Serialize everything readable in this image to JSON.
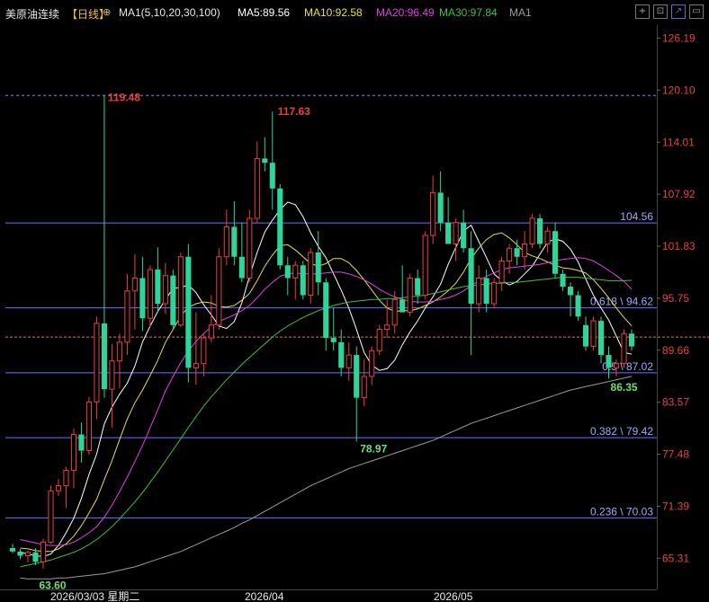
{
  "header": {
    "instrument": "美原油连续",
    "period": "【日线】",
    "target_icon": "crosshair-icon",
    "ma_params": "MA1(5,10,20,30,100)",
    "ma5": "MA5:89.56",
    "ma10": "MA10:92.58",
    "ma20": "MA20:96.49",
    "ma30": "MA30:97.84",
    "ma1": "MA1",
    "icons": [
      "cross-icon",
      "zoom-icon",
      "compare-icon",
      "window-icon"
    ]
  },
  "colors": {
    "up": "#e8403e",
    "down": "#2ed49a",
    "ma5": "#ffffff",
    "ma10": "#e6e040",
    "ma20": "#e040e0",
    "ma30": "#40c040",
    "ma100": "#9a9a9a",
    "fib": "#7070ff",
    "axis_text": "#e8403e",
    "current": "#e8743a"
  },
  "chart_data": {
    "type": "candlestick",
    "y_axis_ticks": [
      "126.19",
      "120.10",
      "114.01",
      "107.92",
      "101.83",
      "95.75",
      "89.66",
      "83.57",
      "77.48",
      "71.39",
      "65.31"
    ],
    "ylim": [
      62.5,
      127.5
    ],
    "x_labels": [
      "2026/03/03 星期二",
      "2026/04",
      "2026/05"
    ],
    "annotations": {
      "high_1": "119.48",
      "high_2": "117.63",
      "low_mid": "78.97",
      "low_start": "63.60",
      "low_recent": "86.35"
    },
    "fib_levels": [
      {
        "label": "104.56",
        "value": 104.56
      },
      {
        "label": "0.618 \\ 94.62",
        "value": 94.62
      },
      {
        "label": "0.5 \\ 87.02",
        "value": 87.02
      },
      {
        "label": "0.382 \\ 79.42",
        "value": 79.42
      },
      {
        "label": "0.236 \\ 70.03",
        "value": 70.03
      }
    ],
    "dashed_level": 119.48,
    "current_price": 91.2,
    "candles": [
      [
        66.5,
        67.0,
        65.9,
        66.1
      ],
      [
        66.1,
        66.4,
        65.2,
        65.6
      ],
      [
        65.6,
        66.2,
        64.8,
        66.0
      ],
      [
        66.0,
        66.5,
        64.5,
        64.9
      ],
      [
        64.9,
        67.6,
        64.1,
        67.2
      ],
      [
        67.2,
        73.8,
        67.0,
        73.2
      ],
      [
        73.2,
        74.6,
        72.6,
        73.8
      ],
      [
        73.8,
        76.0,
        71.2,
        75.6
      ],
      [
        75.6,
        80.5,
        73.5,
        79.8
      ],
      [
        79.8,
        81.2,
        76.5,
        77.9
      ],
      [
        77.9,
        84.2,
        77.4,
        83.6
      ],
      [
        83.6,
        93.6,
        81.6,
        92.8
      ],
      [
        92.8,
        119.5,
        84.1,
        85.1
      ],
      [
        85.1,
        90.4,
        80.6,
        88.4
      ],
      [
        88.4,
        91.6,
        85.2,
        90.6
      ],
      [
        90.6,
        98.6,
        89.1,
        96.6
      ],
      [
        96.6,
        100.9,
        92.1,
        98.1
      ],
      [
        98.1,
        100.6,
        91.9,
        93.4
      ],
      [
        93.4,
        99.6,
        92.4,
        99.1
      ],
      [
        99.1,
        101.7,
        94.1,
        95.1
      ],
      [
        95.1,
        99.9,
        93.9,
        98.4
      ],
      [
        98.4,
        99.1,
        92.1,
        92.6
      ],
      [
        92.6,
        101.1,
        92.4,
        100.6
      ],
      [
        100.6,
        102.1,
        85.9,
        87.6
      ],
      [
        87.6,
        94.1,
        85.6,
        88.1
      ],
      [
        88.1,
        91.6,
        86.6,
        91.1
      ],
      [
        91.1,
        96.1,
        90.6,
        92.6
      ],
      [
        92.6,
        101.6,
        92.1,
        100.6
      ],
      [
        100.6,
        106.1,
        99.6,
        104.1
      ],
      [
        104.1,
        107.1,
        99.6,
        100.6
      ],
      [
        100.6,
        104.6,
        97.6,
        98.1
      ],
      [
        98.1,
        106.1,
        97.6,
        105.1
      ],
      [
        105.1,
        114.1,
        104.6,
        112.1
      ],
      [
        112.1,
        114.6,
        110.6,
        111.6
      ],
      [
        111.6,
        117.6,
        106.1,
        108.6
      ],
      [
        108.6,
        109.1,
        99.1,
        99.6
      ],
      [
        99.6,
        100.6,
        96.1,
        98.1
      ],
      [
        98.1,
        100.1,
        95.6,
        99.6
      ],
      [
        99.6,
        100.1,
        95.6,
        96.1
      ],
      [
        96.1,
        101.6,
        95.1,
        101.1
      ],
      [
        101.1,
        103.6,
        96.1,
        97.6
      ],
      [
        97.6,
        98.1,
        89.6,
        91.1
      ],
      [
        91.1,
        94.6,
        89.6,
        90.6
      ],
      [
        90.6,
        92.1,
        86.6,
        87.6
      ],
      [
        87.6,
        90.6,
        86.1,
        89.1
      ],
      [
        89.1,
        90.1,
        78.97,
        84.1
      ],
      [
        84.1,
        88.6,
        83.1,
        86.6
      ],
      [
        86.6,
        90.1,
        85.6,
        89.6
      ],
      [
        89.6,
        92.6,
        89.1,
        92.1
      ],
      [
        92.1,
        95.6,
        91.1,
        92.6
      ],
      [
        92.6,
        96.6,
        91.6,
        95.6
      ],
      [
        95.6,
        99.6,
        94.6,
        94.1
      ],
      [
        94.1,
        98.6,
        93.6,
        98.1
      ],
      [
        98.1,
        99.1,
        95.1,
        96.1
      ],
      [
        96.1,
        103.6,
        95.6,
        103.1
      ],
      [
        103.1,
        110.1,
        102.1,
        108.1
      ],
      [
        108.1,
        110.6,
        103.6,
        104.6
      ],
      [
        104.6,
        107.6,
        102.6,
        102.1
      ],
      [
        102.1,
        105.1,
        100.1,
        104.6
      ],
      [
        104.6,
        106.1,
        101.1,
        101.6
      ],
      [
        101.6,
        103.6,
        89.1,
        95.1
      ],
      [
        95.1,
        99.6,
        94.1,
        98.1
      ],
      [
        98.1,
        99.1,
        94.1,
        95.1
      ],
      [
        95.1,
        98.1,
        94.6,
        97.6
      ],
      [
        97.6,
        100.6,
        96.6,
        100.1
      ],
      [
        100.1,
        102.1,
        98.6,
        101.6
      ],
      [
        101.6,
        102.6,
        99.6,
        100.6
      ],
      [
        100.6,
        103.6,
        99.1,
        102.1
      ],
      [
        102.1,
        105.6,
        101.6,
        105.1
      ],
      [
        105.1,
        105.6,
        101.6,
        102.1
      ],
      [
        102.1,
        104.1,
        101.1,
        103.6
      ],
      [
        103.6,
        104.6,
        98.1,
        98.6
      ],
      [
        98.6,
        99.1,
        96.6,
        97.1
      ],
      [
        97.1,
        97.6,
        93.6,
        96.1
      ],
      [
        96.1,
        96.6,
        93.1,
        93.6
      ],
      [
        92.6,
        93.6,
        89.6,
        90.1
      ],
      [
        90.1,
        93.6,
        89.6,
        93.1
      ],
      [
        93.1,
        93.6,
        88.1,
        89.1
      ],
      [
        89.1,
        90.1,
        86.35,
        87.6
      ],
      [
        87.6,
        88.6,
        86.6,
        88.1
      ],
      [
        88.1,
        92.1,
        87.6,
        91.6
      ],
      [
        91.6,
        92.1,
        89.6,
        90.1
      ]
    ],
    "moving_averages": [
      {
        "name": "MA5",
        "values": [
          66.0,
          65.8,
          65.6,
          65.5,
          65.8,
          66.8,
          68.3,
          70.0,
          72.3,
          75.1,
          77.5,
          81.0,
          83.0,
          84.5,
          85.8,
          87.8,
          90.6,
          92.5,
          94.2,
          95.6,
          96.9,
          97.0,
          97.3,
          96.4,
          95.0,
          93.8,
          92.5,
          92.2,
          93.0,
          95.2,
          98.3,
          101.1,
          103.5,
          104.9,
          106.1,
          107.0,
          106.7,
          105.3,
          103.4,
          101.8,
          100.5,
          98.6,
          96.7,
          94.6,
          92.1,
          89.4,
          87.9,
          87.3,
          87.5,
          88.5,
          90.3,
          91.8,
          93.1,
          94.6,
          95.9,
          97.4,
          99.7,
          101.7,
          103.6,
          104.3,
          102.4,
          100.5,
          98.6,
          97.8,
          97.3,
          97.7,
          98.6,
          99.5,
          100.9,
          102.3,
          102.7,
          102.4,
          101.5,
          100.0,
          98.0,
          96.1,
          94.6,
          93.2,
          91.3,
          89.4,
          89.2
        ]
      },
      {
        "name": "MA10",
        "values": [
          66.5,
          66.4,
          66.2,
          66.1,
          66.1,
          66.4,
          67.0,
          67.9,
          69.1,
          70.6,
          72.2,
          74.5,
          76.7,
          79.2,
          81.6,
          83.5,
          85.0,
          86.7,
          88.5,
          90.6,
          92.1,
          93.7,
          94.7,
          95.1,
          95.3,
          95.2,
          94.8,
          94.7,
          94.9,
          95.5,
          96.3,
          97.8,
          99.5,
          100.8,
          101.9,
          102.0,
          101.4,
          100.6,
          99.8,
          99.5,
          99.8,
          100.4,
          100.4,
          99.9,
          99.0,
          97.9,
          96.7,
          95.5,
          94.6,
          94.2,
          94.3,
          94.3,
          94.5,
          94.9,
          95.3,
          95.9,
          96.6,
          97.5,
          98.8,
          100.4,
          101.6,
          102.6,
          103.2,
          103.4,
          102.8,
          102.0,
          101.1,
          100.7,
          100.4,
          100.0,
          99.6,
          99.3,
          99.2,
          99.0,
          98.7,
          97.9,
          96.9,
          95.8,
          94.6,
          93.5,
          92.5
        ]
      },
      {
        "name": "MA20",
        "values": [
          67.5,
          67.3,
          67.1,
          66.9,
          66.8,
          66.8,
          66.9,
          67.2,
          67.7,
          68.3,
          69.0,
          70.1,
          71.5,
          73.1,
          74.8,
          76.6,
          78.5,
          80.6,
          82.7,
          84.9,
          86.6,
          88.2,
          89.6,
          90.7,
          91.6,
          92.4,
          93.0,
          93.4,
          93.8,
          94.3,
          94.9,
          95.8,
          96.8,
          97.6,
          98.3,
          98.6,
          98.7,
          98.6,
          98.6,
          98.6,
          98.7,
          98.8,
          98.8,
          98.6,
          98.3,
          97.9,
          97.4,
          96.8,
          96.3,
          95.9,
          95.6,
          95.4,
          95.3,
          95.3,
          95.4,
          95.6,
          95.8,
          96.1,
          96.6,
          97.2,
          97.8,
          98.3,
          98.7,
          99.1,
          99.3,
          99.4,
          99.5,
          99.6,
          99.7,
          99.9,
          100.1,
          100.3,
          100.4,
          100.5,
          100.4,
          100.1,
          99.6,
          99.0,
          98.4,
          97.7,
          96.8
        ]
      },
      {
        "name": "MA30",
        "values": [
          64.3,
          64.5,
          64.7,
          64.9,
          65.1,
          65.4,
          65.7,
          66.0,
          66.4,
          66.9,
          67.5,
          68.2,
          69.0,
          69.9,
          70.9,
          71.9,
          73.0,
          74.2,
          75.4,
          76.7,
          78.0,
          79.3,
          80.6,
          81.9,
          83.1,
          84.2,
          85.2,
          86.2,
          87.1,
          88.0,
          88.8,
          89.6,
          90.4,
          91.2,
          91.9,
          92.5,
          93.0,
          93.5,
          93.9,
          94.3,
          94.6,
          94.9,
          95.1,
          95.3,
          95.4,
          95.5,
          95.6,
          95.6,
          95.7,
          95.7,
          95.8,
          95.9,
          96.0,
          96.1,
          96.3,
          96.5,
          96.7,
          96.9,
          97.1,
          97.2,
          97.3,
          97.4,
          97.5,
          97.5,
          97.6,
          97.6,
          97.7,
          97.8,
          97.9,
          98.0,
          98.1,
          98.2,
          98.2,
          98.2,
          98.1,
          98.0,
          97.9,
          97.8,
          97.8,
          97.8,
          97.84
        ]
      },
      {
        "name": "MA100",
        "values": [
          63.0,
          62.9,
          62.9,
          62.9,
          62.9,
          63.0,
          63.0,
          63.1,
          63.2,
          63.3,
          63.4,
          63.5,
          63.7,
          63.9,
          64.1,
          64.3,
          64.6,
          64.9,
          65.2,
          65.5,
          65.8,
          66.1,
          66.5,
          66.9,
          67.3,
          67.7,
          68.1,
          68.5,
          68.9,
          69.4,
          69.8,
          70.3,
          70.8,
          71.3,
          71.8,
          72.3,
          72.8,
          73.3,
          73.8,
          74.2,
          74.6,
          75.0,
          75.4,
          75.8,
          76.1,
          76.4,
          76.7,
          77.0,
          77.3,
          77.6,
          77.9,
          78.2,
          78.5,
          78.8,
          79.1,
          79.5,
          79.9,
          80.3,
          80.7,
          81.1,
          81.4,
          81.7,
          82.0,
          82.3,
          82.6,
          82.9,
          83.2,
          83.5,
          83.8,
          84.1,
          84.4,
          84.7,
          85.0,
          85.2,
          85.4,
          85.6,
          85.8,
          86.0,
          86.2,
          86.4,
          86.6
        ]
      }
    ]
  }
}
